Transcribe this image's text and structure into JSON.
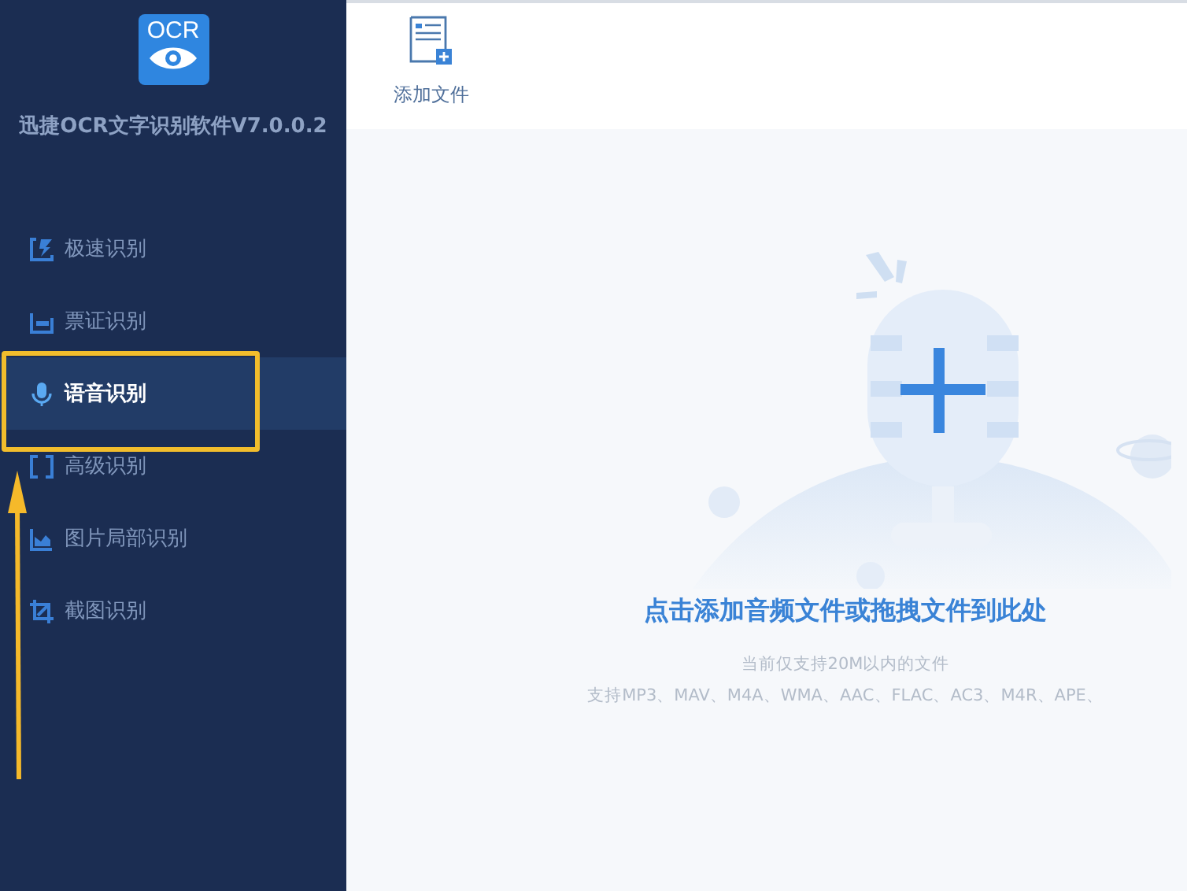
{
  "sidebar": {
    "logo_text": "OCR",
    "app_title": "迅捷OCR文字识别软件V7.0.0.2",
    "items": [
      {
        "label": "极速识别",
        "kind": "fast",
        "selected": false
      },
      {
        "label": "票证识别",
        "kind": "ticket",
        "selected": false
      },
      {
        "label": "语音识别",
        "kind": "voice",
        "selected": true
      },
      {
        "label": "高级识别",
        "kind": "advanced",
        "selected": false
      },
      {
        "label": "图片局部识别",
        "kind": "partial",
        "selected": false
      },
      {
        "label": "截图识别",
        "kind": "screenshot",
        "selected": false
      }
    ]
  },
  "toolbar": {
    "buttons": [
      {
        "label": "添加文件"
      }
    ]
  },
  "drop_area": {
    "prompt": "点击添加音频文件或拖拽文件到此处",
    "hints": [
      "当前仅支持20M以内的文件",
      "支持MP3、MAV、M4A、WMA、AAC、FLAC、AC3、M4R、APE、"
    ]
  }
}
